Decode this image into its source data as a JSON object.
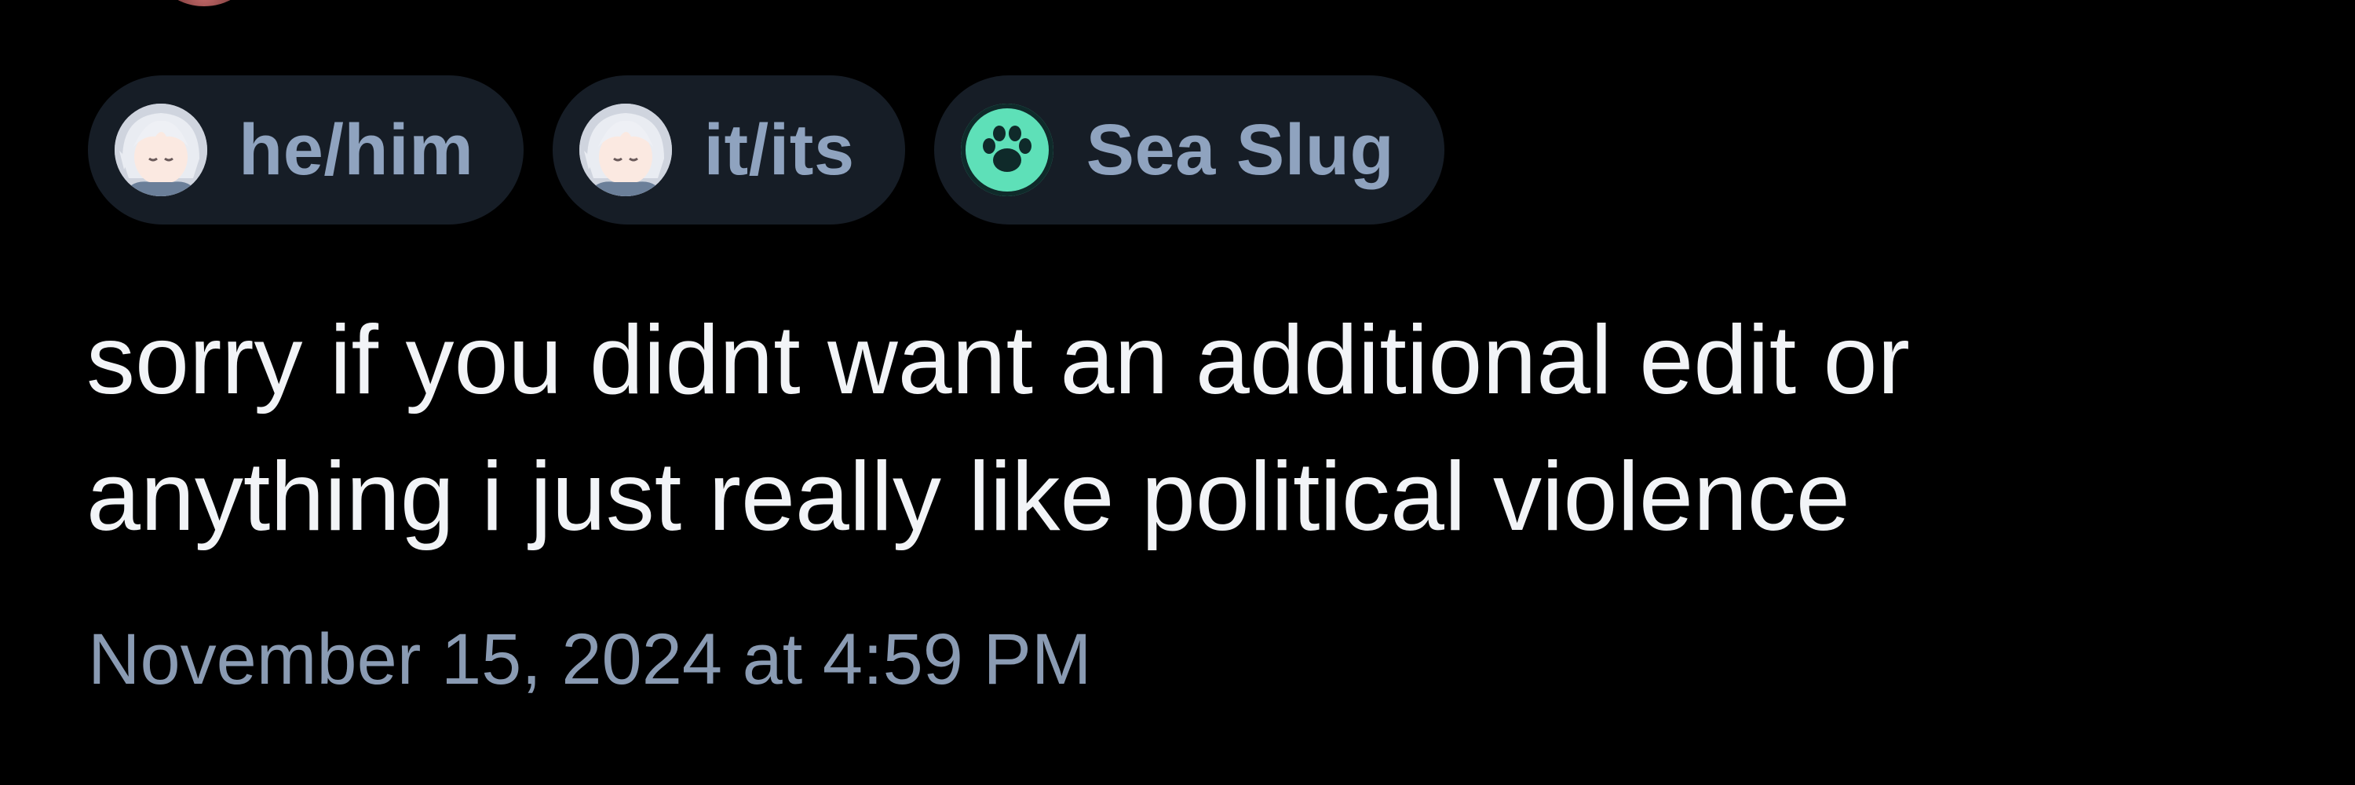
{
  "tags": [
    {
      "label": "he/him",
      "icon": "anime-avatar-icon"
    },
    {
      "label": "it/its",
      "icon": "anime-avatar-icon"
    },
    {
      "label": "Sea Slug",
      "icon": "paw-print-icon",
      "icon_color": "#5ee0b8"
    }
  ],
  "post": {
    "text": "sorry if you didnt want an additional edit or anything i just really like political violence",
    "timestamp": "November 15, 2024 at 4:59 PM"
  },
  "colors": {
    "background": "#000000",
    "pill_background": "#161d26",
    "pill_text": "#8fa3bf",
    "body_text": "#f2f4f7",
    "timestamp_text": "#8a9bb3"
  }
}
